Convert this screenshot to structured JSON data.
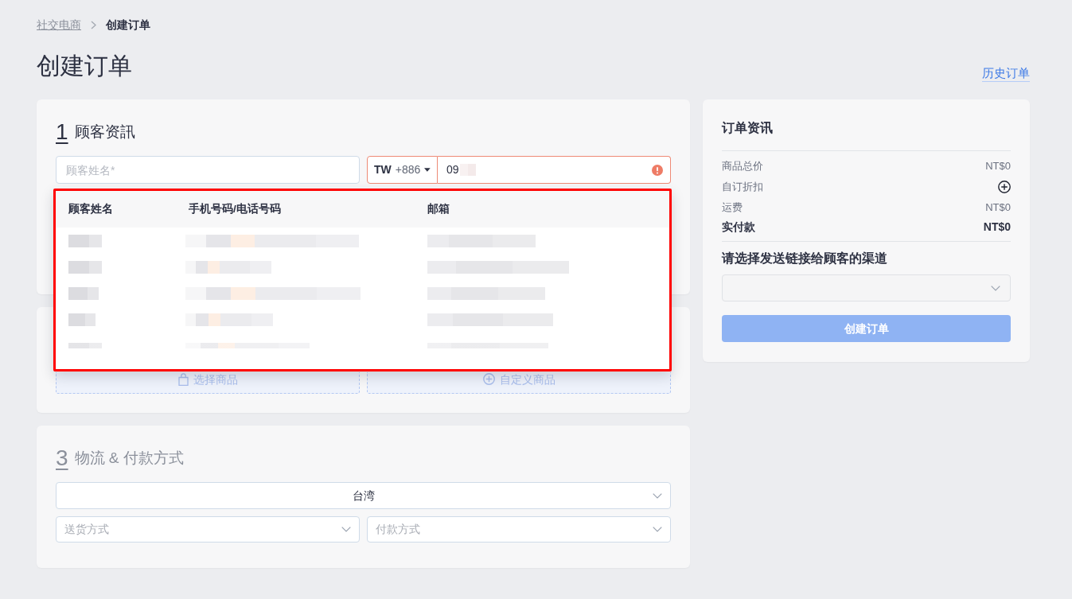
{
  "breadcrumb": [
    {
      "label": "社交电商",
      "current": false
    },
    {
      "label": "创建订单",
      "current": true
    }
  ],
  "page_title": "创建订单",
  "history_link": "历史订单",
  "customer_section": {
    "number": "1",
    "title": "顾客资訊",
    "active": true,
    "name_field": {
      "placeholder": "顾客姓名*"
    },
    "phone_field": {
      "country": "TW",
      "dial_code": "+886",
      "value": "09",
      "redacted_suffix": true,
      "error": true
    }
  },
  "customer_dropdown": {
    "highlighted": true,
    "columns": [
      "顾客姓名",
      "手机号码/电话号码",
      "邮箱"
    ],
    "rows": [
      {
        "kind": "redacted"
      },
      {
        "kind": "redacted"
      },
      {
        "kind": "redacted"
      },
      {
        "kind": "redacted"
      },
      {
        "kind": "redacted"
      }
    ]
  },
  "products_section": {
    "buttons": [
      {
        "label": "选择商品",
        "disabled": true
      },
      {
        "label": "自定义商品",
        "disabled": true
      }
    ]
  },
  "shipping_section": {
    "number": "3",
    "title": "物流 & 付款方式",
    "active": false,
    "country_select": {
      "value": "台湾"
    },
    "selects": [
      {
        "placeholder": "送货方式"
      },
      {
        "placeholder": "付款方式"
      }
    ]
  },
  "order_summary": {
    "title": "订单资讯",
    "lines": [
      {
        "kind": "amount",
        "label": "商品总价",
        "value": "NT$0"
      },
      {
        "kind": "add",
        "label": "自订折扣"
      },
      {
        "kind": "amount",
        "label": "运费",
        "value": "NT$0"
      },
      {
        "kind": "total",
        "label": "实付款",
        "value": "NT$0"
      }
    ],
    "channel_label": "请选择发送链接给顾客的渠道",
    "submit": {
      "label": "创建订单",
      "disabled": true
    }
  }
}
